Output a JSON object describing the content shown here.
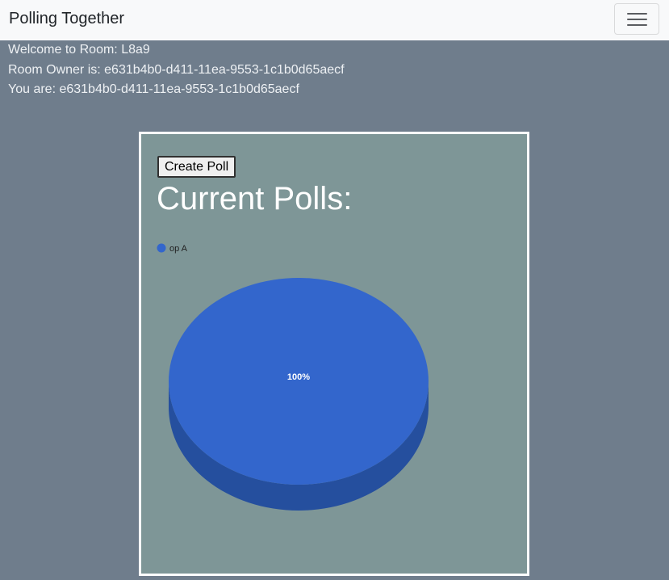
{
  "navbar": {
    "brand": "Polling Together",
    "menu_icon": "hamburger-menu-icon"
  },
  "room": {
    "welcome": "Welcome to Room: L8a9",
    "owner": "Room Owner is: e631b4b0-d411-11ea-9553-1c1b0d65aecf",
    "you": "You are: e631b4b0-d411-11ea-9553-1c1b0d65aecf"
  },
  "polls": {
    "create_button": "Create Poll",
    "heading": "Current Polls:"
  },
  "chart_data": {
    "type": "pie",
    "categories": [
      "op A"
    ],
    "values": [
      100
    ],
    "data_labels": [
      "100%"
    ],
    "legend_position": "top-left",
    "colors": {
      "slice": "#3366cc",
      "slice_side": "#254f9e",
      "panel_bg": "#7e9697"
    },
    "style": "3d"
  }
}
